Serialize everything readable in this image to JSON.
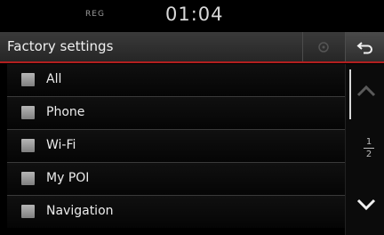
{
  "status": {
    "source": "REG",
    "time": "01:04"
  },
  "header": {
    "title": "Factory settings",
    "refresh_icon": "refresh-icon",
    "back_icon": "back-arrow-icon"
  },
  "list": {
    "items": [
      {
        "label": "All",
        "checked": false
      },
      {
        "label": "Phone",
        "checked": false
      },
      {
        "label": "Wi-Fi",
        "checked": false
      },
      {
        "label": "My POI",
        "checked": false
      },
      {
        "label": "Navigation",
        "checked": false
      }
    ]
  },
  "pager": {
    "current": "1",
    "total": "2"
  },
  "colors": {
    "accent": "#b21f1f",
    "background": "#000000"
  }
}
